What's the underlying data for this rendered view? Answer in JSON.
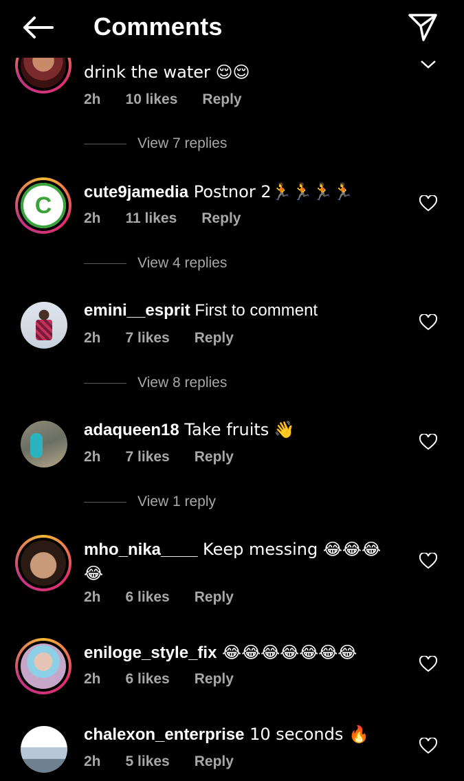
{
  "header": {
    "title": "Comments"
  },
  "comments": [
    {
      "user": "",
      "text": "drink the water 😌😌",
      "time": "2h",
      "likes": "10 likes",
      "reply": "Reply",
      "view_replies": "View 7 replies"
    },
    {
      "user": "cute9jamedia",
      "text": " Postnor  2🏃🏃🏃🏃",
      "time": "2h",
      "likes": "11 likes",
      "reply": "Reply",
      "view_replies": "View 4 replies"
    },
    {
      "user": "emini__esprit",
      "text": " First to comment",
      "time": "2h",
      "likes": "7 likes",
      "reply": "Reply",
      "view_replies": "View 8 replies"
    },
    {
      "user": "adaqueen18",
      "text": " Take fruits 👋",
      "time": "2h",
      "likes": "7 likes",
      "reply": "Reply",
      "view_replies": "View 1 reply"
    },
    {
      "user": "mho_nika____",
      "text": " Keep messing 😂😂😂😂",
      "time": "2h",
      "likes": "6 likes",
      "reply": "Reply"
    },
    {
      "user": "eniloge_style_fix",
      "text": " 😂😂😂😂😂😂😂",
      "time": "2h",
      "likes": "6 likes",
      "reply": "Reply"
    },
    {
      "user": "chalexon_enterprise",
      "text": " 10 seconds 🔥",
      "time": "2h",
      "likes": "5 likes",
      "reply": "Reply"
    }
  ],
  "colors": {
    "accent": "#e1306c",
    "muted": "#a8a8a8",
    "background": "#000000"
  },
  "icons": {
    "back": "arrow-left-icon",
    "send": "paper-plane-icon",
    "like": "heart-outline-icon"
  }
}
